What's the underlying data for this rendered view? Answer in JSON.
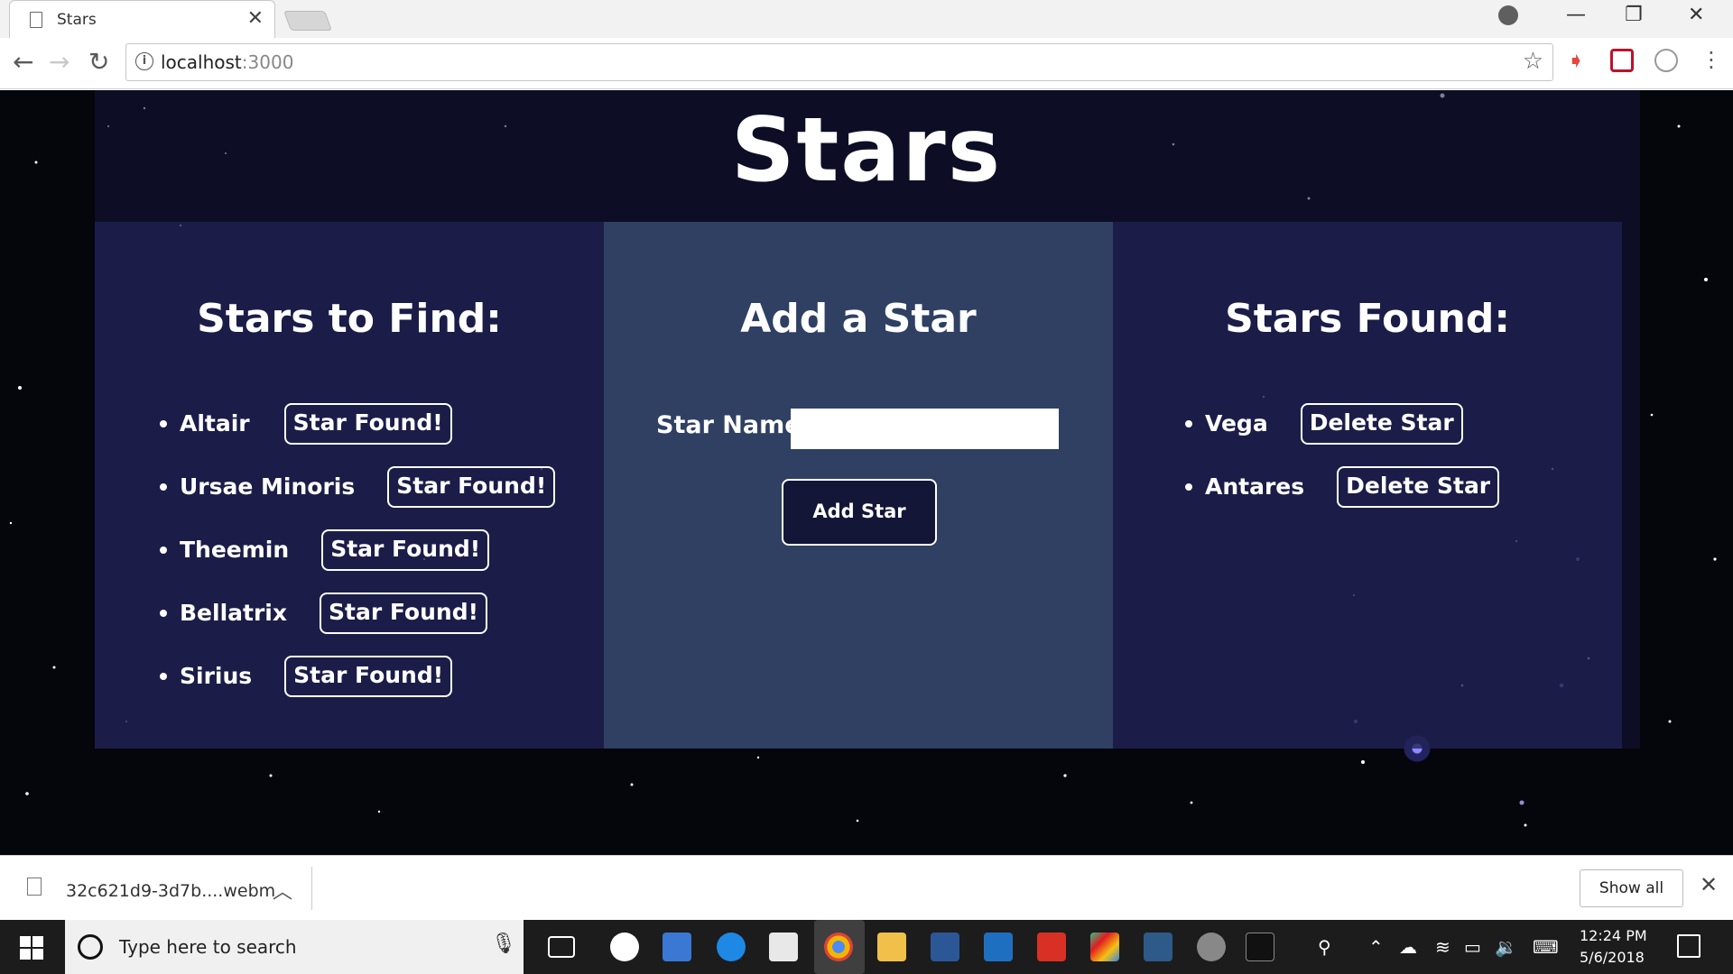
{
  "browser": {
    "tab_title": "Stars",
    "tab_close": "✕",
    "url_host": "localhost",
    "url_port": ":3000",
    "window_minimize": "—",
    "window_restore": "❐",
    "window_close": "✕"
  },
  "page": {
    "heading": "Stars",
    "left": {
      "title": "Stars to Find:",
      "items": [
        {
          "name": "Altair",
          "button": "Star Found!"
        },
        {
          "name": "Ursae Minoris",
          "button": "Star Found!"
        },
        {
          "name": "Theemin",
          "button": "Star Found!"
        },
        {
          "name": "Bellatrix",
          "button": "Star Found!"
        },
        {
          "name": "Sirius",
          "button": "Star Found!"
        }
      ]
    },
    "middle": {
      "title": "Add a Star",
      "field_label": "Star Name:",
      "field_value": "",
      "button": "Add Star"
    },
    "right": {
      "title": "Stars Found:",
      "items": [
        {
          "name": "Vega",
          "button": "Delete Star"
        },
        {
          "name": "Antares",
          "button": "Delete Star"
        }
      ]
    }
  },
  "downloads": {
    "file_name": "32c621d9-3d7b....webm",
    "show_all": "Show all",
    "close": "✕"
  },
  "taskbar": {
    "search_placeholder": "Type here to search",
    "time": "12:24 PM",
    "date": "5/6/2018"
  },
  "colors": {
    "accent_mid_panel": "#2f4063",
    "add_button_bg": "#141638",
    "space_bg": "#05050c"
  }
}
